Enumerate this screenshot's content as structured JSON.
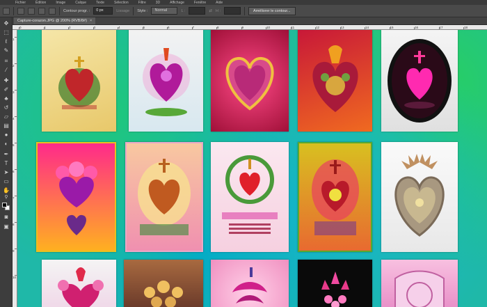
{
  "menu": {
    "items": [
      "Fichier",
      "Édition",
      "Image",
      "Calque",
      "Texte",
      "Sélection",
      "Filtre",
      "3D",
      "Affichage",
      "Fenêtre",
      "Aide"
    ]
  },
  "options": {
    "contour_label": "Contour progr. :",
    "contour_value": "0 px",
    "lissage_label": "Lissage",
    "style_label": "Style :",
    "style_value": "Normal",
    "l_label": "L :",
    "h_label": "H :",
    "ameliorer_label": "Améliorer le contour..."
  },
  "document": {
    "tab_title": "Capture-corazon.JPG @ 200% (RVB/8#)",
    "close_glyph": "×"
  },
  "ruler": {
    "top_ticks": [
      "0",
      "1",
      "2",
      "3",
      "4",
      "5",
      "6",
      "7",
      "8",
      "9",
      "10",
      "11",
      "12",
      "13",
      "14",
      "15",
      "16",
      "17",
      "18",
      "19"
    ],
    "left_ticks": [
      "1",
      "2",
      "3",
      "4",
      "5",
      "6",
      "7",
      "8",
      "9",
      "10"
    ]
  },
  "tools": [
    "move-tool-icon",
    "marquee-tool-icon",
    "lasso-tool-icon",
    "quick-select-tool-icon",
    "crop-tool-icon",
    "eyedropper-tool-icon",
    "healing-tool-icon",
    "brush-tool-icon",
    "stamp-tool-icon",
    "history-brush-tool-icon",
    "eraser-tool-icon",
    "gradient-tool-icon",
    "blur-tool-icon",
    "dodge-tool-icon",
    "pen-tool-icon",
    "type-tool-icon",
    "path-select-tool-icon",
    "shape-tool-icon",
    "hand-tool-icon",
    "zoom-tool-icon"
  ],
  "colors": {
    "foreground": "#000000",
    "background": "#ffffff"
  }
}
